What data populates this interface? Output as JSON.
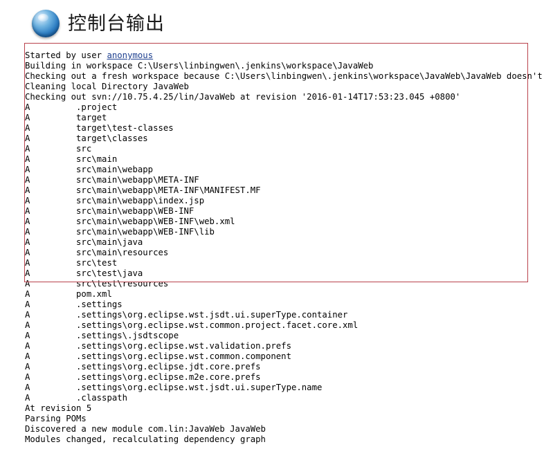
{
  "header": {
    "title": "控制台输出",
    "icon": "blue-sphere-icon"
  },
  "colors": {
    "highlight_border": "#b8414b",
    "link": "#1d3f8f",
    "background": "#ffffff",
    "text": "#000000"
  },
  "console": {
    "user_link_label": "anonymous",
    "lines": [
      {
        "prefix": "Started by user ",
        "link": "anonymous",
        "suffix": ""
      },
      {
        "text": "Building in workspace C:\\Users\\linbingwen\\.jenkins\\workspace\\JavaWeb"
      },
      {
        "text": "Checking out a fresh workspace because C:\\Users\\linbingwen\\.jenkins\\workspace\\JavaWeb\\JavaWeb doesn't exist"
      },
      {
        "text": "Cleaning local Directory JavaWeb"
      },
      {
        "text": "Checking out svn://10.75.4.25/lin/JavaWeb at revision '2016-01-14T17:53:23.045 +0800'"
      },
      {
        "text": "A         .project"
      },
      {
        "text": "A         target"
      },
      {
        "text": "A         target\\test-classes"
      },
      {
        "text": "A         target\\classes"
      },
      {
        "text": "A         src"
      },
      {
        "text": "A         src\\main"
      },
      {
        "text": "A         src\\main\\webapp"
      },
      {
        "text": "A         src\\main\\webapp\\META-INF"
      },
      {
        "text": "A         src\\main\\webapp\\META-INF\\MANIFEST.MF"
      },
      {
        "text": "A         src\\main\\webapp\\index.jsp"
      },
      {
        "text": "A         src\\main\\webapp\\WEB-INF"
      },
      {
        "text": "A         src\\main\\webapp\\WEB-INF\\web.xml"
      },
      {
        "text": "A         src\\main\\webapp\\WEB-INF\\lib"
      },
      {
        "text": "A         src\\main\\java"
      },
      {
        "text": "A         src\\main\\resources"
      },
      {
        "text": "A         src\\test"
      },
      {
        "text": "A         src\\test\\java"
      },
      {
        "text": "A         src\\test\\resources"
      },
      {
        "text": "A         pom.xml"
      },
      {
        "text": "A         .settings"
      },
      {
        "text": "A         .settings\\org.eclipse.wst.jsdt.ui.superType.container"
      },
      {
        "text": "A         .settings\\org.eclipse.wst.common.project.facet.core.xml"
      },
      {
        "text": "A         .settings\\.jsdtscope"
      },
      {
        "text": "A         .settings\\org.eclipse.wst.validation.prefs"
      },
      {
        "text": "A         .settings\\org.eclipse.wst.common.component"
      },
      {
        "text": "A         .settings\\org.eclipse.jdt.core.prefs"
      },
      {
        "text": "A         .settings\\org.eclipse.m2e.core.prefs"
      },
      {
        "text": "A         .settings\\org.eclipse.wst.jsdt.ui.superType.name"
      },
      {
        "text": "A         .classpath"
      },
      {
        "text": "At revision 5"
      },
      {
        "text": "Parsing POMs"
      },
      {
        "text": "Discovered a new module com.lin:JavaWeb JavaWeb"
      },
      {
        "text": "Modules changed, recalculating dependency graph"
      }
    ]
  }
}
